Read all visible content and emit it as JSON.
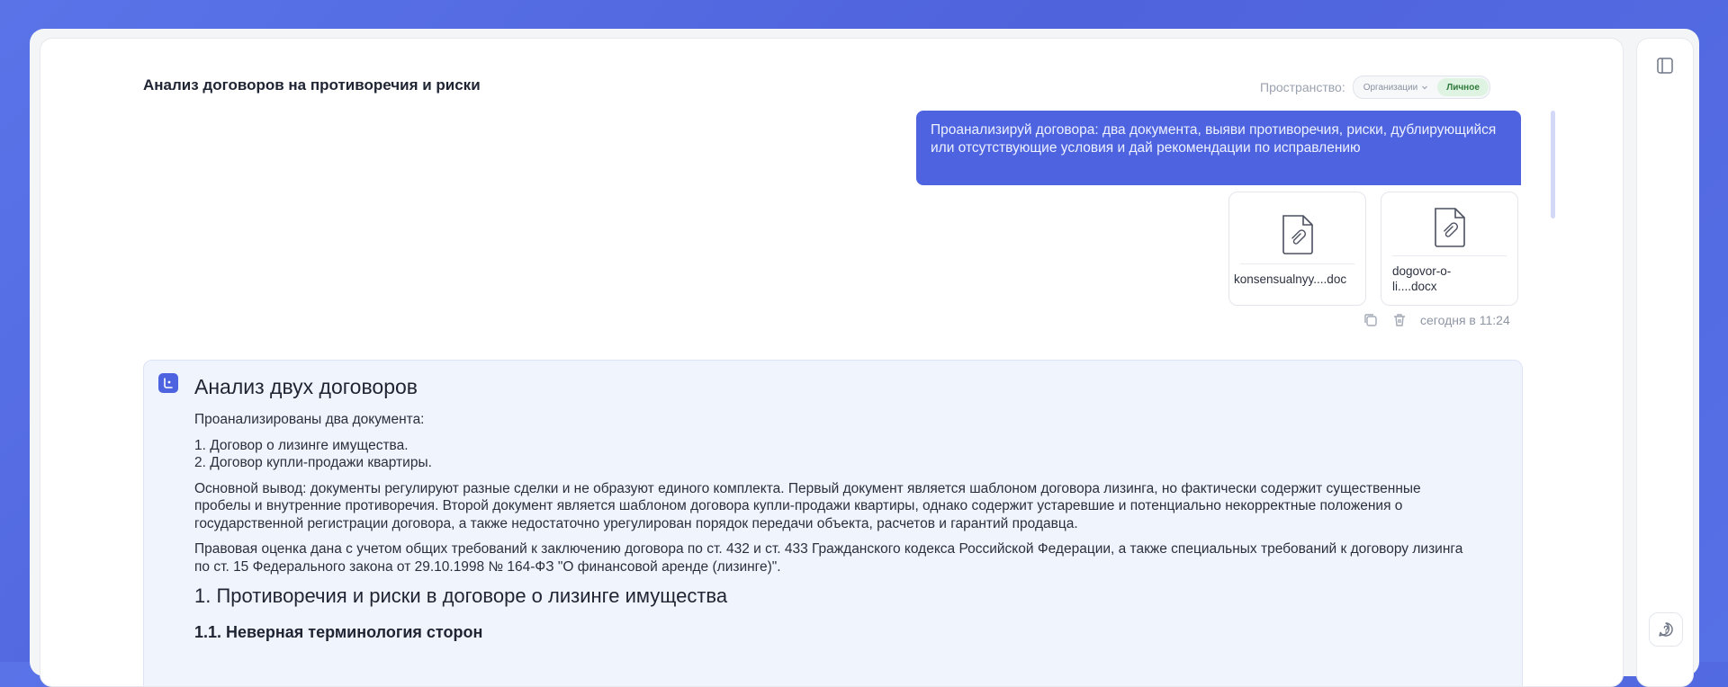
{
  "header": {
    "title": "Анализ договоров на противоречия и риски",
    "space_label": "Пространство:",
    "space_options": [
      "Организации",
      "Личное"
    ],
    "space_selected": "Личное"
  },
  "user_message": {
    "text": "Проанализируй договора: два документа, выяви противоречия, риски, дублирующийся или отсутствующие условия и дай рекомендации по исправлению",
    "attachments": [
      {
        "name": "konsensualnyy....doc",
        "icon": "attachment-file-icon"
      },
      {
        "name": "dogovor-o-li....docx",
        "icon": "attachment-file-icon"
      }
    ],
    "timestamp": "сегодня в 11:24"
  },
  "answer": {
    "heading": "Анализ двух договоров",
    "intro": "Проанализированы два документа:",
    "list": [
      "1. Договор о лизинге имущества.",
      "2. Договор купли-продажи квартиры."
    ],
    "conclusion": "Основной вывод: документы регулируют разные сделки и не образуют единого комплекта. Первый документ является шаблоном договора лизинга, но фактически содержит существенные пробелы и внутренние противоречия. Второй документ является шаблоном договора купли-продажи квартиры, однако содержит устаревшие и потенциально некорректные положения о государственной регистрации договора, а также недостаточно урегулирован порядок передачи объекта, расчетов и гарантий продавца.",
    "legal": "Правовая оценка дана с учетом общих требований к заключению договора по ст. 432 и ст. 433 Гражданского кодекса Российской Федерации, а также специальных требований к договору лизинга по ст. 15 Федерального закона от 29.10.1998 № 164-ФЗ \"О финансовой аренде (лизинге)\".",
    "section1": "1. Противоречия и риски в договоре о лизинге имущества",
    "section1_1": "1.1. Неверная терминология сторон"
  },
  "colors": {
    "accent": "#4d63df",
    "background": "#5a74e8",
    "active_space": "#dff3e2"
  }
}
